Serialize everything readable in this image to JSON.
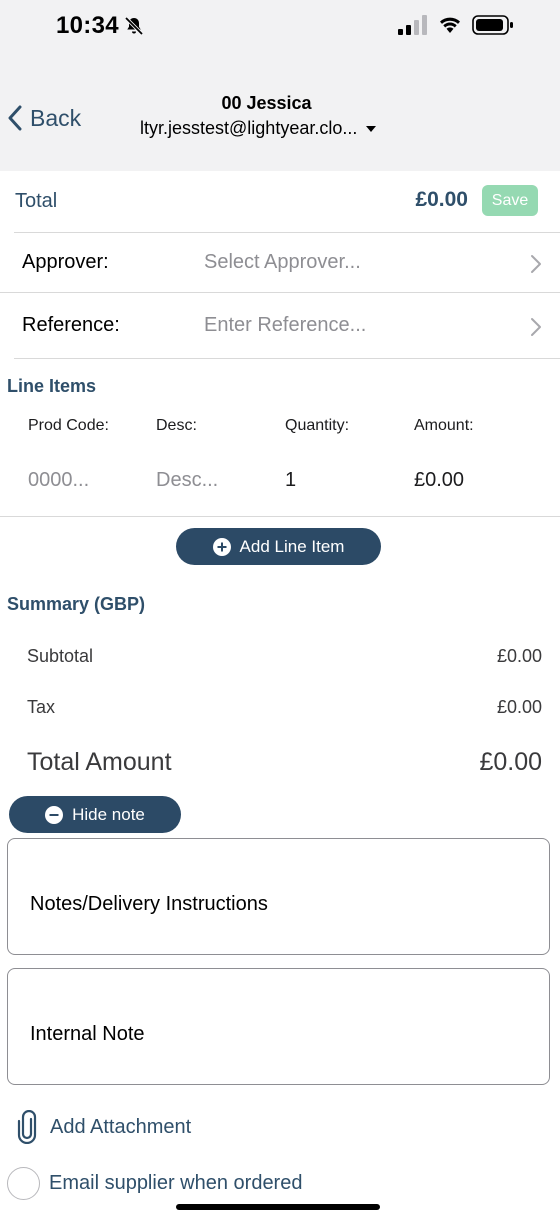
{
  "status_bar": {
    "time": "10:34"
  },
  "header": {
    "back_label": "Back",
    "title": "00 Jessica",
    "subtitle": "ltyr.jesstest@lightyear.clo..."
  },
  "total": {
    "label": "Total",
    "amount": "£0.00",
    "save_label": "Save"
  },
  "fields": {
    "approver_label": "Approver:",
    "approver_placeholder": "Select Approver...",
    "reference_label": "Reference:",
    "reference_placeholder": "Enter Reference..."
  },
  "line_items": {
    "title": "Line Items",
    "columns": [
      "Prod Code:",
      "Desc:",
      "Quantity:",
      "Amount:"
    ],
    "row": {
      "prod_code": "0000...",
      "desc": "Desc...",
      "quantity": "1",
      "amount": "£0.00"
    },
    "add_label": "Add Line Item"
  },
  "summary": {
    "title": "Summary (GBP)",
    "subtotal_label": "Subtotal",
    "subtotal_value": "£0.00",
    "tax_label": "Tax",
    "tax_value": "£0.00",
    "total_label": "Total Amount",
    "total_value": "£0.00"
  },
  "notes": {
    "hide_label": "Hide note",
    "delivery_placeholder": "Notes/Delivery Instructions",
    "internal_placeholder": "Internal Note"
  },
  "attachment_label": "Add Attachment",
  "email_label": "Email supplier when ordered",
  "colors": {
    "brand": "#2c4a66",
    "save_disabled": "#95d9b2",
    "header_bg": "#f2f2f3"
  }
}
